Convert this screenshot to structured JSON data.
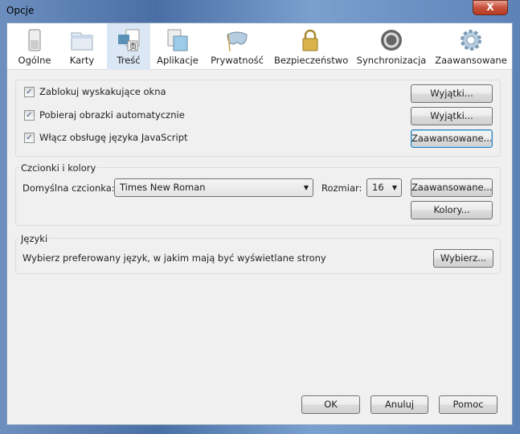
{
  "window": {
    "title": "Opcje",
    "close_label": "X"
  },
  "tabs": [
    {
      "label": "Ogólne",
      "icon": "switch-icon"
    },
    {
      "label": "Karty",
      "icon": "folder-tabs-icon"
    },
    {
      "label": "Treść",
      "icon": "content-icon",
      "selected": true
    },
    {
      "label": "Aplikacje",
      "icon": "applications-icon"
    },
    {
      "label": "Prywatność",
      "icon": "mask-icon"
    },
    {
      "label": "Bezpieczeństwo",
      "icon": "padlock-icon"
    },
    {
      "label": "Synchronizacja",
      "icon": "sync-icon"
    },
    {
      "label": "Zaawansowane",
      "icon": "gear-icon"
    }
  ],
  "content": {
    "popups": {
      "label": "Zablokuj wyskakujące okna",
      "checked": true,
      "button": "Wyjątki..."
    },
    "images": {
      "label": "Pobieraj obrazki automatycznie",
      "checked": true,
      "button": "Wyjątki..."
    },
    "javascript": {
      "label": "Włącz obsługę języka JavaScript",
      "checked": true,
      "button": "Zaawansowane..."
    }
  },
  "fonts": {
    "title": "Czcionki i kolory",
    "default_font_label": "Domyślna czcionka:",
    "default_font": "Times New Roman",
    "size_label": "Rozmiar:",
    "size": "16",
    "advanced_button": "Zaawansowane...",
    "colors_button": "Kolory..."
  },
  "languages": {
    "title": "Języki",
    "text": "Wybierz preferowany język, w jakim mają być wyświetlane strony",
    "choose_button": "Wybierz..."
  },
  "footer": {
    "ok": "OK",
    "cancel": "Anuluj",
    "help": "Pomoc"
  }
}
